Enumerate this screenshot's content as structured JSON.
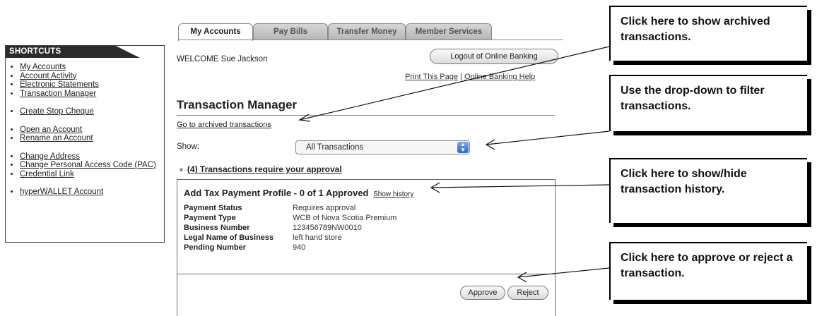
{
  "tabs": [
    "My Accounts",
    "Pay Bills",
    "Transfer Money",
    "Member Services"
  ],
  "sidebar": {
    "title": "SHORTCUTS",
    "groups": [
      [
        "My Accounts",
        "Account Activity",
        "Electronic Statements",
        "Transaction Manager"
      ],
      [
        "Create Stop Cheque"
      ],
      [
        "Open an Account",
        "Rename an Account"
      ],
      [
        "Change Address",
        "Change Personal Access Code (PAC)",
        "Credential Link"
      ],
      [
        "hyperWALLET Account"
      ]
    ]
  },
  "header": {
    "welcome": "WELCOME Sue Jackson",
    "logout": "Logout of Online Banking",
    "print": "Print This Page",
    "help": "Online Banking Help",
    "separator": "|"
  },
  "main": {
    "title": "Transaction Manager",
    "archived_link": "Go to archived transactions",
    "show_label": "Show:",
    "filter_value": "All Transactions",
    "approval_header": "(4) Transactions require your approval"
  },
  "card": {
    "title": "Add Tax Payment Profile - 0 of 1 Approved",
    "history_link": "Show history",
    "rows": [
      {
        "label": "Payment Status",
        "value": "Requires approval"
      },
      {
        "label": "Payment Type",
        "value": "WCB of Nova Scotia Premium"
      },
      {
        "label": "Business Number",
        "value": "123456789NW0010"
      },
      {
        "label": "Legal Name of Business",
        "value": "left hand store"
      },
      {
        "label": "Pending Number",
        "value": "940"
      }
    ],
    "approve": "Approve",
    "reject": "Reject"
  },
  "callouts": [
    "Click here to show archived transactions.",
    "Use the drop-down to filter transactions.",
    "Click here to show/hide transaction history.",
    "Click here to approve or reject a transaction."
  ],
  "icons": {
    "select_arrows": "updown-arrows-icon",
    "disclosure": "triangle-down-icon"
  }
}
